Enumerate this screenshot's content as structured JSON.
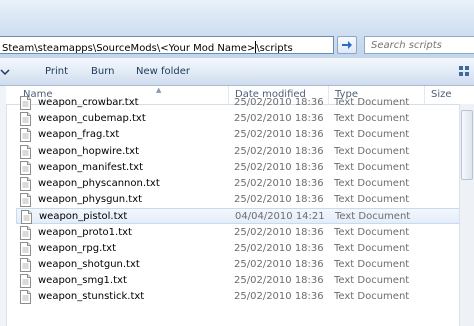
{
  "address_bar": {
    "path_before_caret": "Steam\\steamapps\\SourceMods\\<Your Mod Name>",
    "path_after_caret": "\\scripts"
  },
  "search": {
    "placeholder": "Search scripts"
  },
  "toolbar": {
    "print_label": "Print",
    "burn_label": "Burn",
    "new_folder_label": "New folder"
  },
  "columns": {
    "name": "Name",
    "date_modified": "Date modified",
    "type": "Type",
    "size": "Size"
  },
  "files": [
    {
      "name": "weapon_crowbar.txt",
      "date": "25/02/2010 18:36",
      "type": "Text Document"
    },
    {
      "name": "weapon_cubemap.txt",
      "date": "25/02/2010 18:36",
      "type": "Text Document"
    },
    {
      "name": "weapon_frag.txt",
      "date": "25/02/2010 18:36",
      "type": "Text Document"
    },
    {
      "name": "weapon_hopwire.txt",
      "date": "25/02/2010 18:36",
      "type": "Text Document"
    },
    {
      "name": "weapon_manifest.txt",
      "date": "25/02/2010 18:36",
      "type": "Text Document"
    },
    {
      "name": "weapon_physcannon.txt",
      "date": "25/02/2010 18:36",
      "type": "Text Document"
    },
    {
      "name": "weapon_physgun.txt",
      "date": "25/02/2010 18:36",
      "type": "Text Document"
    },
    {
      "name": "weapon_pistol.txt",
      "date": "04/04/2010 14:21",
      "type": "Text Document"
    },
    {
      "name": "weapon_proto1.txt",
      "date": "25/02/2010 18:36",
      "type": "Text Document"
    },
    {
      "name": "weapon_rpg.txt",
      "date": "25/02/2010 18:36",
      "type": "Text Document"
    },
    {
      "name": "weapon_shotgun.txt",
      "date": "25/02/2010 18:36",
      "type": "Text Document"
    },
    {
      "name": "weapon_smg1.txt",
      "date": "25/02/2010 18:36",
      "type": "Text Document"
    },
    {
      "name": "weapon_stunstick.txt",
      "date": "25/02/2010 18:36",
      "type": "Text Document"
    }
  ],
  "selected_file": "weapon_pistol.txt",
  "icons": {
    "go": "arrow-right-icon",
    "file": "text-document-icon",
    "toolbar_menu": "chevron-down-icon",
    "view": "view-options-icon"
  },
  "colors": {
    "toolbar_text": "#1e395b",
    "selection_border": "#c9d9ee",
    "go_arrow": "#2b6cc4"
  }
}
